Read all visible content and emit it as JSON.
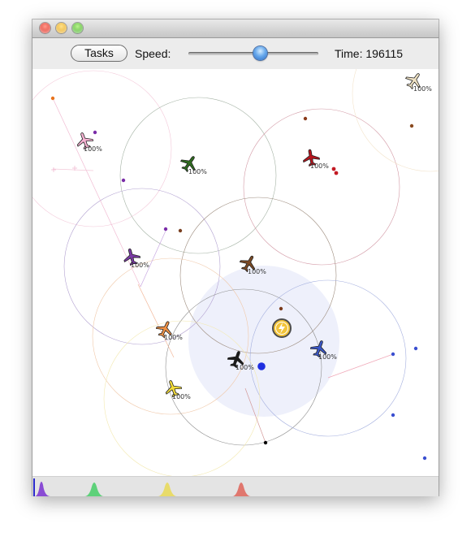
{
  "window": {
    "title": ""
  },
  "toolbar": {
    "tasks_label": "Tasks",
    "speed_label": "Speed:",
    "speed_value": 0.55,
    "time_text": "Time: 196115"
  },
  "planes": [
    {
      "id": "pink",
      "color": "#f7b3d3",
      "label": "100%"
    },
    {
      "id": "green",
      "color": "#2f6b1f",
      "label": "100%"
    },
    {
      "id": "red",
      "color": "#b8141d",
      "label": "100%"
    },
    {
      "id": "beige",
      "color": "#efe2c4",
      "label": "100%"
    },
    {
      "id": "purple",
      "color": "#7b3aa6",
      "label": "100%"
    },
    {
      "id": "brown",
      "color": "#7b4a25",
      "label": "100%"
    },
    {
      "id": "orange",
      "color": "#f09246",
      "label": "100%"
    },
    {
      "id": "black",
      "color": "#1a1a1a",
      "label": "100%"
    },
    {
      "id": "blue",
      "color": "#3a57c9",
      "label": "100%"
    },
    {
      "id": "yellow",
      "color": "#f4dd3a",
      "label": "100%"
    }
  ],
  "icons": {
    "plane": "airplane-icon",
    "power": "lightning-bolt-icon",
    "base": "base-station-dot"
  },
  "histogram_colors": [
    "#8a4cd4",
    "#5ed17a",
    "#e8db6a",
    "#e0776e"
  ]
}
